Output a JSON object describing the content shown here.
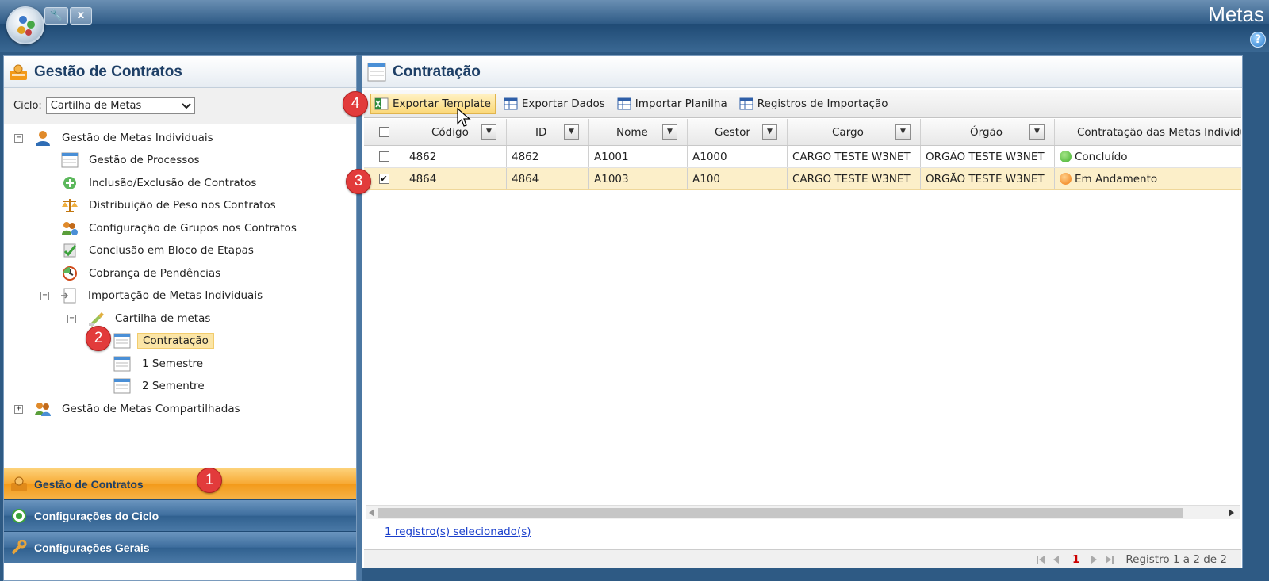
{
  "topbar": {
    "title": "Metas",
    "tab_close": "x",
    "help": "?"
  },
  "left_panel": {
    "header": "Gestão de Contratos",
    "ciclo_label": "Ciclo:",
    "ciclo_value": "Cartilha de Metas",
    "tree": {
      "root1": "Gestão de Metas Individuais",
      "processos": "Gestão de Processos",
      "inclusao": "Inclusão/Exclusão de Contratos",
      "distribuicao": "Distribuição de Peso nos Contratos",
      "configuracao": "Configuração de Grupos nos Contratos",
      "conclusao": "Conclusão em Bloco de Etapas",
      "cobranca": "Cobrança de Pendências",
      "importacao": "Importação de Metas Individuais",
      "cartilha": "Cartilha de metas",
      "contratacao": "Contratação",
      "semestre1": "1 Semestre",
      "semestre2": "2 Sementre",
      "root2": "Gestão de Metas Compartilhadas"
    },
    "accordion": {
      "gestao": "Gestão de Contratos",
      "ciclo": "Configurações do Ciclo",
      "gerais": "Configurações Gerais"
    }
  },
  "right_panel": {
    "header": "Contratação",
    "toolbar": {
      "exportar_template": "Exportar Template",
      "exportar_dados": "Exportar Dados",
      "importar_planilha": "Importar Planilha",
      "registros": "Registros de Importação"
    },
    "columns": {
      "codigo": "Código",
      "id": "ID",
      "nome": "Nome",
      "gestor": "Gestor",
      "cargo": "Cargo",
      "orgao": "Órgão",
      "contratacao": "Contratação das Metas Individuai"
    },
    "rows": [
      {
        "checked": "",
        "codigo": "4862",
        "id": "4862",
        "nome": "A1001",
        "gestor": "A1000",
        "cargo": "CARGO TESTE W3NET",
        "orgao": "ORGÃO TESTE W3NET",
        "status": "Concluído",
        "status_color": "#3fae2a"
      },
      {
        "checked": "✔",
        "codigo": "4864",
        "id": "4864",
        "nome": "A1003",
        "gestor": "A100",
        "cargo": "CARGO TESTE W3NET",
        "orgao": "ORGÃO TESTE W3NET",
        "status": "Em Andamento",
        "status_color": "#f39a1a"
      }
    ],
    "footer_link": "1 registro(s) selecionado(s)",
    "pager": {
      "current": "1",
      "summary": "Registro 1 a 2 de 2"
    }
  },
  "badges": {
    "b1": "1",
    "b2": "2",
    "b3": "3",
    "b4": "4"
  }
}
